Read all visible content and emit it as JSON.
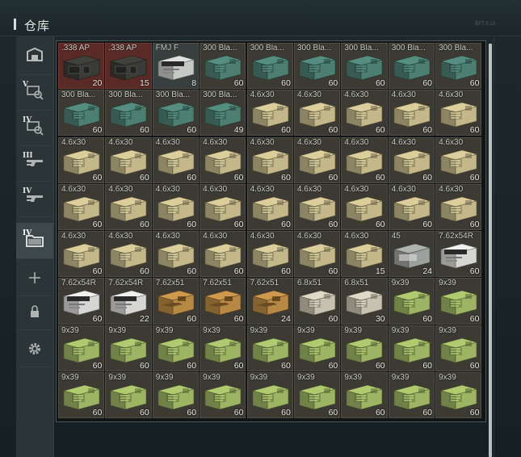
{
  "window": {
    "title": "仓库",
    "tag": "EFT 0.13"
  },
  "sidebar": {
    "items": [
      {
        "id": "base",
        "icon": "stash-icon",
        "roman": "",
        "active": false
      },
      {
        "id": "tab-v",
        "icon": "key-icon",
        "roman": "V",
        "active": false
      },
      {
        "id": "tab-iv-a",
        "icon": "key-icon",
        "roman": "IV",
        "active": false
      },
      {
        "id": "tab-iii",
        "icon": "gun-icon",
        "roman": "III",
        "active": false
      },
      {
        "id": "tab-iv-b",
        "icon": "gun-icon",
        "roman": "IV",
        "active": false
      },
      {
        "id": "tab-iv-c",
        "icon": "folder-icon",
        "roman": "IV",
        "active": true
      },
      {
        "id": "add",
        "icon": "plus-icon",
        "roman": "",
        "active": false
      },
      {
        "id": "lock",
        "icon": "lock-icon",
        "roman": "",
        "active": false
      },
      {
        "id": "settings",
        "icon": "gear-icon",
        "roman": "",
        "active": false
      }
    ]
  },
  "ammo_colors": {
    "338": "#3a3a36",
    "fmj_white": "#c7c9c7",
    "blackout": "#4c7f72",
    "46x30": "#c4b88a",
    "45": "#9da19d",
    "762x54R": "#d6d7d5",
    "762x51": "#b88944",
    "68x51": "#c6c2af",
    "9x39": "#9cb463"
  },
  "grid": {
    "rows": [
      [
        {
          "label": ".338 AP",
          "count": "20",
          "kind": "338",
          "cls": "cls-red"
        },
        {
          "label": ".338 AP",
          "count": "15",
          "kind": "338",
          "cls": "cls-red"
        },
        {
          "label": "FMJ F",
          "count": "8",
          "kind": "fmj_white",
          "cls": "cls-slate"
        },
        {
          "label": "300 Bla...",
          "count": "60",
          "kind": "blackout",
          "cls": ""
        },
        {
          "label": "300 Bla...",
          "count": "60",
          "kind": "blackout",
          "cls": ""
        },
        {
          "label": "300 Bla...",
          "count": "60",
          "kind": "blackout",
          "cls": ""
        },
        {
          "label": "300 Bla...",
          "count": "60",
          "kind": "blackout",
          "cls": ""
        },
        {
          "label": "300 Bla...",
          "count": "60",
          "kind": "blackout",
          "cls": ""
        },
        {
          "label": "300 Bla...",
          "count": "60",
          "kind": "blackout",
          "cls": ""
        }
      ],
      [
        {
          "label": "300 Bla...",
          "count": "60",
          "kind": "blackout",
          "cls": ""
        },
        {
          "label": "300 Bla...",
          "count": "60",
          "kind": "blackout",
          "cls": ""
        },
        {
          "label": "300 Bla...",
          "count": "60",
          "kind": "blackout",
          "cls": ""
        },
        {
          "label": "300 Bla...",
          "count": "49",
          "kind": "blackout",
          "cls": ""
        },
        {
          "label": "4.6x30",
          "count": "60",
          "kind": "46x30",
          "cls": ""
        },
        {
          "label": "4.6x30",
          "count": "60",
          "kind": "46x30",
          "cls": ""
        },
        {
          "label": "4.6x30",
          "count": "60",
          "kind": "46x30",
          "cls": ""
        },
        {
          "label": "4.6x30",
          "count": "60",
          "kind": "46x30",
          "cls": ""
        },
        {
          "label": "4.6x30",
          "count": "60",
          "kind": "46x30",
          "cls": ""
        }
      ],
      [
        {
          "label": "4.6x30",
          "count": "60",
          "kind": "46x30",
          "cls": ""
        },
        {
          "label": "4.6x30",
          "count": "60",
          "kind": "46x30",
          "cls": ""
        },
        {
          "label": "4.6x30",
          "count": "60",
          "kind": "46x30",
          "cls": ""
        },
        {
          "label": "4.6x30",
          "count": "60",
          "kind": "46x30",
          "cls": ""
        },
        {
          "label": "4.6x30",
          "count": "60",
          "kind": "46x30",
          "cls": ""
        },
        {
          "label": "4.6x30",
          "count": "60",
          "kind": "46x30",
          "cls": ""
        },
        {
          "label": "4.6x30",
          "count": "60",
          "kind": "46x30",
          "cls": ""
        },
        {
          "label": "4.6x30",
          "count": "60",
          "kind": "46x30",
          "cls": ""
        },
        {
          "label": "4.6x30",
          "count": "60",
          "kind": "46x30",
          "cls": ""
        }
      ],
      [
        {
          "label": "4.6x30",
          "count": "60",
          "kind": "46x30",
          "cls": ""
        },
        {
          "label": "4.6x30",
          "count": "60",
          "kind": "46x30",
          "cls": ""
        },
        {
          "label": "4.6x30",
          "count": "60",
          "kind": "46x30",
          "cls": ""
        },
        {
          "label": "4.6x30",
          "count": "60",
          "kind": "46x30",
          "cls": ""
        },
        {
          "label": "4.6x30",
          "count": "60",
          "kind": "46x30",
          "cls": ""
        },
        {
          "label": "4.6x30",
          "count": "60",
          "kind": "46x30",
          "cls": ""
        },
        {
          "label": "4.6x30",
          "count": "60",
          "kind": "46x30",
          "cls": ""
        },
        {
          "label": "4.6x30",
          "count": "60",
          "kind": "46x30",
          "cls": ""
        },
        {
          "label": "4.6x30",
          "count": "60",
          "kind": "46x30",
          "cls": ""
        }
      ],
      [
        {
          "label": "4.6x30",
          "count": "60",
          "kind": "46x30",
          "cls": ""
        },
        {
          "label": "4.6x30",
          "count": "60",
          "kind": "46x30",
          "cls": ""
        },
        {
          "label": "4.6x30",
          "count": "60",
          "kind": "46x30",
          "cls": ""
        },
        {
          "label": "4.6x30",
          "count": "60",
          "kind": "46x30",
          "cls": ""
        },
        {
          "label": "4.6x30",
          "count": "60",
          "kind": "46x30",
          "cls": ""
        },
        {
          "label": "4.6x30",
          "count": "60",
          "kind": "46x30",
          "cls": ""
        },
        {
          "label": "4.6x30",
          "count": "15",
          "kind": "46x30",
          "cls": ""
        },
        {
          "label": "45",
          "count": "24",
          "kind": "45",
          "cls": ""
        },
        {
          "label": "7.62x54R",
          "count": "60",
          "kind": "762x54R",
          "cls": ""
        }
      ],
      [
        {
          "label": "7.62x54R",
          "count": "60",
          "kind": "762x54R",
          "cls": ""
        },
        {
          "label": "7.62x54R",
          "count": "22",
          "kind": "762x54R",
          "cls": ""
        },
        {
          "label": "7.62x51",
          "count": "60",
          "kind": "762x51",
          "cls": ""
        },
        {
          "label": "7.62x51",
          "count": "60",
          "kind": "762x51",
          "cls": ""
        },
        {
          "label": "7.62x51",
          "count": "24",
          "kind": "762x51",
          "cls": ""
        },
        {
          "label": "6.8x51",
          "count": "60",
          "kind": "68x51",
          "cls": ""
        },
        {
          "label": "6.8x51",
          "count": "30",
          "kind": "68x51",
          "cls": ""
        },
        {
          "label": "9x39",
          "count": "60",
          "kind": "9x39",
          "cls": ""
        },
        {
          "label": "9x39",
          "count": "60",
          "kind": "9x39",
          "cls": ""
        }
      ],
      [
        {
          "label": "9x39",
          "count": "60",
          "kind": "9x39",
          "cls": ""
        },
        {
          "label": "9x39",
          "count": "60",
          "kind": "9x39",
          "cls": ""
        },
        {
          "label": "9x39",
          "count": "60",
          "kind": "9x39",
          "cls": ""
        },
        {
          "label": "9x39",
          "count": "60",
          "kind": "9x39",
          "cls": ""
        },
        {
          "label": "9x39",
          "count": "60",
          "kind": "9x39",
          "cls": ""
        },
        {
          "label": "9x39",
          "count": "60",
          "kind": "9x39",
          "cls": ""
        },
        {
          "label": "9x39",
          "count": "60",
          "kind": "9x39",
          "cls": ""
        },
        {
          "label": "9x39",
          "count": "60",
          "kind": "9x39",
          "cls": ""
        },
        {
          "label": "9x39",
          "count": "60",
          "kind": "9x39",
          "cls": ""
        }
      ],
      [
        {
          "label": "9x39",
          "count": "60",
          "kind": "9x39",
          "cls": ""
        },
        {
          "label": "9x39",
          "count": "60",
          "kind": "9x39",
          "cls": ""
        },
        {
          "label": "9x39",
          "count": "60",
          "kind": "9x39",
          "cls": ""
        },
        {
          "label": "9x39",
          "count": "60",
          "kind": "9x39",
          "cls": ""
        },
        {
          "label": "9x39",
          "count": "60",
          "kind": "9x39",
          "cls": ""
        },
        {
          "label": "9x39",
          "count": "60",
          "kind": "9x39",
          "cls": ""
        },
        {
          "label": "9x39",
          "count": "60",
          "kind": "9x39",
          "cls": ""
        },
        {
          "label": "9x39",
          "count": "60",
          "kind": "9x39",
          "cls": ""
        },
        {
          "label": "9x39",
          "count": "60",
          "kind": "9x39",
          "cls": ""
        }
      ]
    ]
  }
}
